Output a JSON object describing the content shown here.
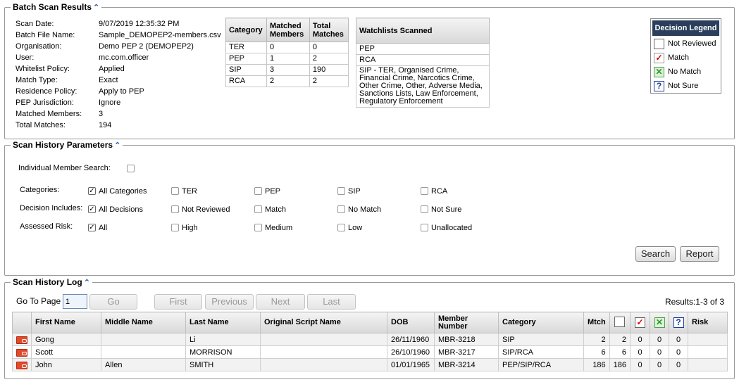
{
  "batch": {
    "title": "Batch Scan Results",
    "rows": [
      {
        "key": "Scan Date:",
        "value": "9/07/2019 12:35:32 PM"
      },
      {
        "key": "Batch File Name:",
        "value": "Sample_DEMOPEP2-members.csv"
      },
      {
        "key": "Organisation:",
        "value": "Demo PEP 2 (DEMOPEP2)"
      },
      {
        "key": "User:",
        "value": "mc.com.officer"
      },
      {
        "key": "Whitelist Policy:",
        "value": "Applied"
      },
      {
        "key": "Match Type:",
        "value": "Exact"
      },
      {
        "key": "Residence Policy:",
        "value": "Apply to PEP"
      },
      {
        "key": "PEP Jurisdiction:",
        "value": "Ignore"
      },
      {
        "key": "Matched Members:",
        "value": "3"
      },
      {
        "key": "Total Matches:",
        "value": "194"
      }
    ],
    "category_table": {
      "headers": [
        "Category",
        "Matched Members",
        "Total Matches"
      ],
      "rows": [
        [
          "TER",
          "0",
          "0"
        ],
        [
          "PEP",
          "1",
          "2"
        ],
        [
          "SIP",
          "3",
          "190"
        ],
        [
          "RCA",
          "2",
          "2"
        ]
      ]
    },
    "watchlists": {
      "header": "Watchlists Scanned",
      "rows": [
        "PEP",
        "RCA",
        "SIP - TER, Organised Crime, Financial Crime, Narcotics Crime, Other Crime, Other, Adverse Media, Sanctions Lists, Law Enforcement, Regulatory Enforcement"
      ]
    },
    "decision_legend": {
      "title": "Decision Legend",
      "items": [
        {
          "icon": "empty-box-icon",
          "label": "Not Reviewed"
        },
        {
          "icon": "checkmark-icon",
          "label": "Match"
        },
        {
          "icon": "cross-icon",
          "label": "No Match"
        },
        {
          "icon": "question-icon",
          "label": "Not Sure"
        }
      ]
    }
  },
  "params": {
    "title": "Scan History Parameters",
    "individual_label": "Individual Member Search:",
    "categories": {
      "label": "Categories:",
      "options": [
        {
          "label": "All Categories",
          "checked": true
        },
        {
          "label": "TER",
          "checked": false
        },
        {
          "label": "PEP",
          "checked": false
        },
        {
          "label": "SIP",
          "checked": false
        },
        {
          "label": "RCA",
          "checked": false
        }
      ]
    },
    "decisions": {
      "label": "Decision Includes:",
      "options": [
        {
          "label": "All Decisions",
          "checked": true
        },
        {
          "label": "Not Reviewed",
          "checked": false
        },
        {
          "label": "Match",
          "checked": false
        },
        {
          "label": "No Match",
          "checked": false
        },
        {
          "label": "Not Sure",
          "checked": false
        }
      ]
    },
    "risk": {
      "label": "Assessed Risk:",
      "options": [
        {
          "label": "All",
          "checked": true
        },
        {
          "label": "High",
          "checked": false
        },
        {
          "label": "Medium",
          "checked": false
        },
        {
          "label": "Low",
          "checked": false
        },
        {
          "label": "Unallocated",
          "checked": false
        }
      ]
    },
    "search_label": "Search",
    "report_label": "Report"
  },
  "log": {
    "title": "Scan History Log",
    "goto_label": "Go To Page",
    "page_value": "1",
    "go_label": "Go",
    "first_label": "First",
    "previous_label": "Previous",
    "next_label": "Next",
    "last_label": "Last",
    "results_text": "Results:1-3 of 3",
    "headers": {
      "first": "First Name",
      "middle": "Middle Name",
      "last": "Last Name",
      "original": "Original Script Name",
      "dob": "DOB",
      "member": "Member Number",
      "category": "Category",
      "mtch": "Mtch",
      "risk": "Risk"
    },
    "rows": [
      {
        "first": "Gong",
        "middle": "",
        "last": "Li",
        "original": "",
        "dob": "26/11/1960",
        "member": "MBR-3218",
        "category": "SIP",
        "mtch": "2",
        "nr": "2",
        "m": "0",
        "nm": "0",
        "ns": "0",
        "risk": ""
      },
      {
        "first": "Scott",
        "middle": "",
        "last": "MORRISON",
        "original": "",
        "dob": "26/10/1960",
        "member": "MBR-3217",
        "category": "SIP/RCA",
        "mtch": "6",
        "nr": "6",
        "m": "0",
        "nm": "0",
        "ns": "0",
        "risk": ""
      },
      {
        "first": "John",
        "middle": "Allen",
        "last": "SMITH",
        "original": "",
        "dob": "01/01/1965",
        "member": "MBR-3214",
        "category": "PEP/SIP/RCA",
        "mtch": "186",
        "nr": "186",
        "m": "0",
        "nm": "0",
        "ns": "0",
        "risk": ""
      }
    ]
  }
}
